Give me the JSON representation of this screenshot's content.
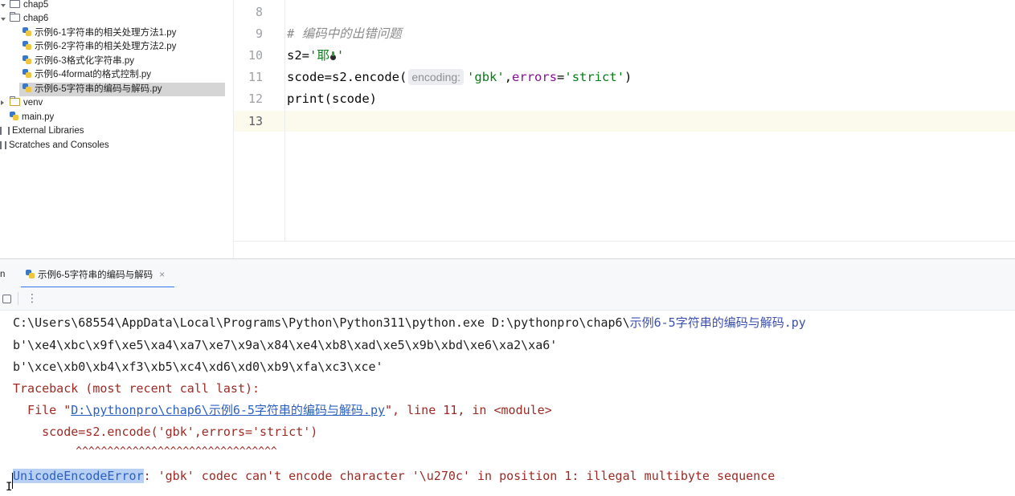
{
  "tree": {
    "items": [
      {
        "label": "chap5",
        "type": "folder"
      },
      {
        "label": "chap6",
        "type": "folder"
      },
      {
        "label": "示例6-1字符串的相关处理方法1.py",
        "type": "python-file"
      },
      {
        "label": "示例6-2字符串的相关处理方法2.py",
        "type": "python-file"
      },
      {
        "label": "示例6-3格式化字符串.py",
        "type": "python-file"
      },
      {
        "label": "示例6-4format的格式控制.py",
        "type": "python-file"
      },
      {
        "label": "示例6-5字符串的编码与解码.py",
        "type": "python-file",
        "selected": true
      },
      {
        "label": "venv",
        "type": "folder"
      },
      {
        "label": "main.py",
        "type": "python-file"
      },
      {
        "label": "External Libraries",
        "type": "library"
      },
      {
        "label": "Scratches and Consoles",
        "type": "scratches"
      }
    ]
  },
  "editor": {
    "line_numbers": [
      "8",
      "9",
      "10",
      "11",
      "12",
      "13"
    ],
    "current_line": "13",
    "lines": {
      "l9_comment": "# 编码中的出错问题",
      "l10_var": "s2=",
      "l10_str_open": "'耶",
      "l10_str_close": "'",
      "l11_prefix": "scode=s2.encode(",
      "l11_hint": "encoding:",
      "l11_arg1": "'gbk'",
      "l11_comma": ",",
      "l11_kw": "errors",
      "l11_eq": "=",
      "l11_arg2": "'strict'",
      "l11_close": ")",
      "l12": "print(scode)"
    }
  },
  "run_panel": {
    "label": "n",
    "tab_label": "示例6-5字符串的编码与解码",
    "tab_close": "×",
    "toolbar_more": "⋮"
  },
  "console": {
    "command_prefix": "C:\\Users\\68554\\AppData\\Local\\Programs\\Python\\Python311\\python.exe D:\\pythonpro\\chap6\\",
    "command_file": "示例6-5字符串的编码与解码.py",
    "out1": "b'\\xe4\\xbc\\x9f\\xe5\\xa4\\xa7\\xe7\\x9a\\x84\\xe4\\xb8\\xad\\xe5\\x9b\\xbd\\xe6\\xa2\\xa6'",
    "out2": "b'\\xce\\xb0\\xb4\\xf3\\xb5\\xc4\\xd6\\xd0\\xb9\\xfa\\xc3\\xce'",
    "traceback": "Traceback (most recent call last):",
    "file_prefix": "  File \"",
    "file_link": "D:\\pythonpro\\chap6\\示例6-5字符串的编码与解码.py",
    "file_suffix": "\", line 11, in <module>",
    "code_line": "    scode=s2.encode('gbk',errors='strict')",
    "carets": "          ^^^^^^^^^^^^^^^^^^^^^^^^^^^^^^^^",
    "error_name": "UnicodeEncodeError",
    "error_msg": ": 'gbk' codec can't encode character '\\u270c' in position 1: illegal multibyte sequence"
  }
}
